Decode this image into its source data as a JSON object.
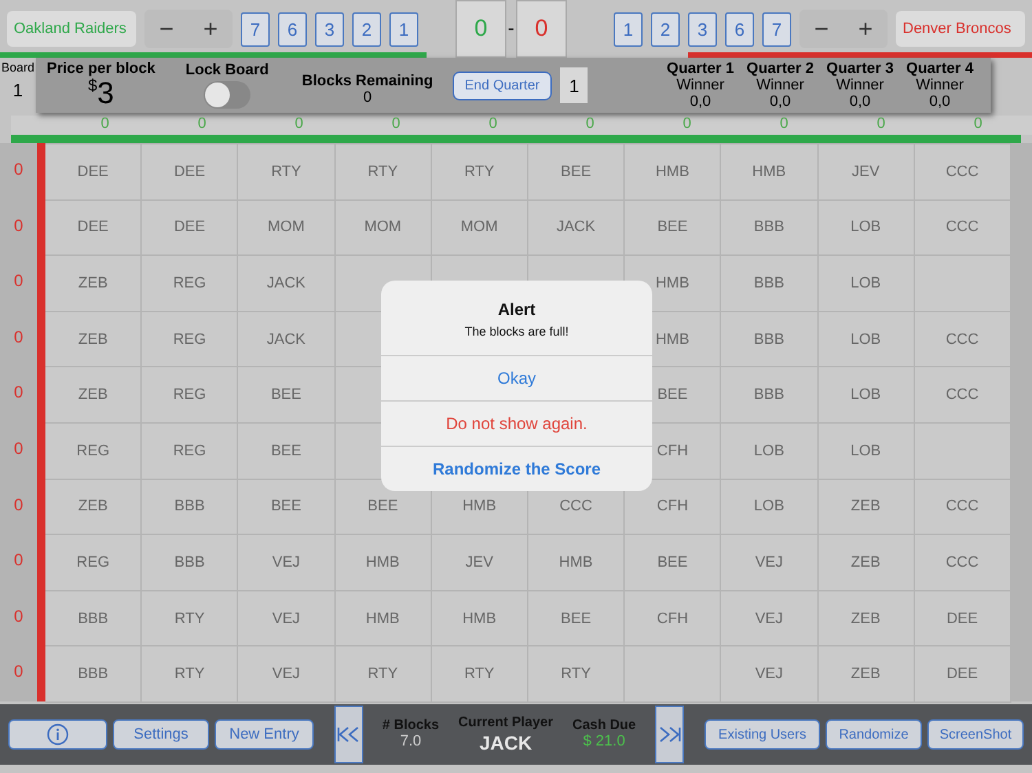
{
  "home": {
    "team": "Oakland Raiders",
    "color": "#2ea84a",
    "minus": "−",
    "plus": "+",
    "digits": [
      "7",
      "6",
      "3",
      "2",
      "1"
    ]
  },
  "score": {
    "home": "0",
    "separator": "-",
    "away": "0"
  },
  "away": {
    "team": "Denver Broncos",
    "color": "#d9302c",
    "minus": "−",
    "plus": "+",
    "digits": [
      "1",
      "2",
      "3",
      "6",
      "7"
    ]
  },
  "board": {
    "label": "Board",
    "number": "1"
  },
  "info": {
    "price_label": "Price per block",
    "currency": "$",
    "price": "3",
    "lock_label": "Lock Board",
    "lock_on": false,
    "remaining_label": "Blocks Remaining",
    "remaining": "0",
    "end_quarter": "End Quarter",
    "quarter": "1",
    "quarters": [
      {
        "title": "Quarter 1",
        "label": "Winner",
        "value": "0,0"
      },
      {
        "title": "Quarter 2",
        "label": "Winner",
        "value": "0,0"
      },
      {
        "title": "Quarter 3",
        "label": "Winner",
        "value": "0,0"
      },
      {
        "title": "Quarter 4",
        "label": "Winner",
        "value": "0,0"
      }
    ]
  },
  "column_numbers": [
    "0",
    "0",
    "0",
    "0",
    "0",
    "0",
    "0",
    "0",
    "0",
    "0"
  ],
  "rows": [
    {
      "number": "0",
      "cells": [
        "DEE",
        "DEE",
        "RTY",
        "RTY",
        "RTY",
        "BEE",
        "HMB",
        "HMB",
        "JEV",
        "CCC"
      ]
    },
    {
      "number": "0",
      "cells": [
        "DEE",
        "DEE",
        "MOM",
        "MOM",
        "MOM",
        "JACK",
        "BEE",
        "BBB",
        "LOB",
        "CCC"
      ]
    },
    {
      "number": "0",
      "cells": [
        "ZEB",
        "REG",
        "JACK",
        null,
        null,
        null,
        "HMB",
        "BBB",
        "LOB",
        null
      ]
    },
    {
      "number": "0",
      "cells": [
        "ZEB",
        "REG",
        "JACK",
        null,
        null,
        null,
        "HMB",
        "BBB",
        "LOB",
        "CCC"
      ]
    },
    {
      "number": "0",
      "cells": [
        "ZEB",
        "REG",
        "BEE",
        null,
        null,
        null,
        "BEE",
        "BBB",
        "LOB",
        "CCC"
      ]
    },
    {
      "number": "0",
      "cells": [
        "REG",
        "REG",
        "BEE",
        null,
        null,
        null,
        "CFH",
        "LOB",
        "LOB",
        null
      ]
    },
    {
      "number": "0",
      "cells": [
        "ZEB",
        "BBB",
        "BEE",
        "BEE",
        "HMB",
        "CCC",
        "CFH",
        "LOB",
        "ZEB",
        "CCC"
      ]
    },
    {
      "number": "0",
      "cells": [
        "REG",
        "BBB",
        "VEJ",
        "HMB",
        "JEV",
        "HMB",
        "BEE",
        "VEJ",
        "ZEB",
        "CCC"
      ]
    },
    {
      "number": "0",
      "cells": [
        "BBB",
        "RTY",
        "VEJ",
        "HMB",
        "HMB",
        "BEE",
        "CFH",
        "VEJ",
        "ZEB",
        "DEE"
      ]
    },
    {
      "number": "0",
      "cells": [
        "BBB",
        "RTY",
        "VEJ",
        "RTY",
        "RTY",
        "RTY",
        null,
        "VEJ",
        "ZEB",
        "DEE"
      ]
    }
  ],
  "alert": {
    "title": "Alert",
    "message": "The blocks are full!",
    "actions": [
      {
        "label": "Okay",
        "kind": "default"
      },
      {
        "label": "Do not show again.",
        "kind": "destructive"
      },
      {
        "label": "Randomize the Score",
        "kind": "preferred"
      }
    ]
  },
  "bottom": {
    "left_buttons": [
      "Settings",
      "New Entry"
    ],
    "blocks_label": "# Blocks",
    "blocks": "7.0",
    "player_label": "Current Player",
    "player": "JACK",
    "cash_label": "Cash Due",
    "cash": "$  21.0",
    "right_buttons": [
      "Existing Users",
      "Randomize",
      "ScreenShot"
    ]
  }
}
